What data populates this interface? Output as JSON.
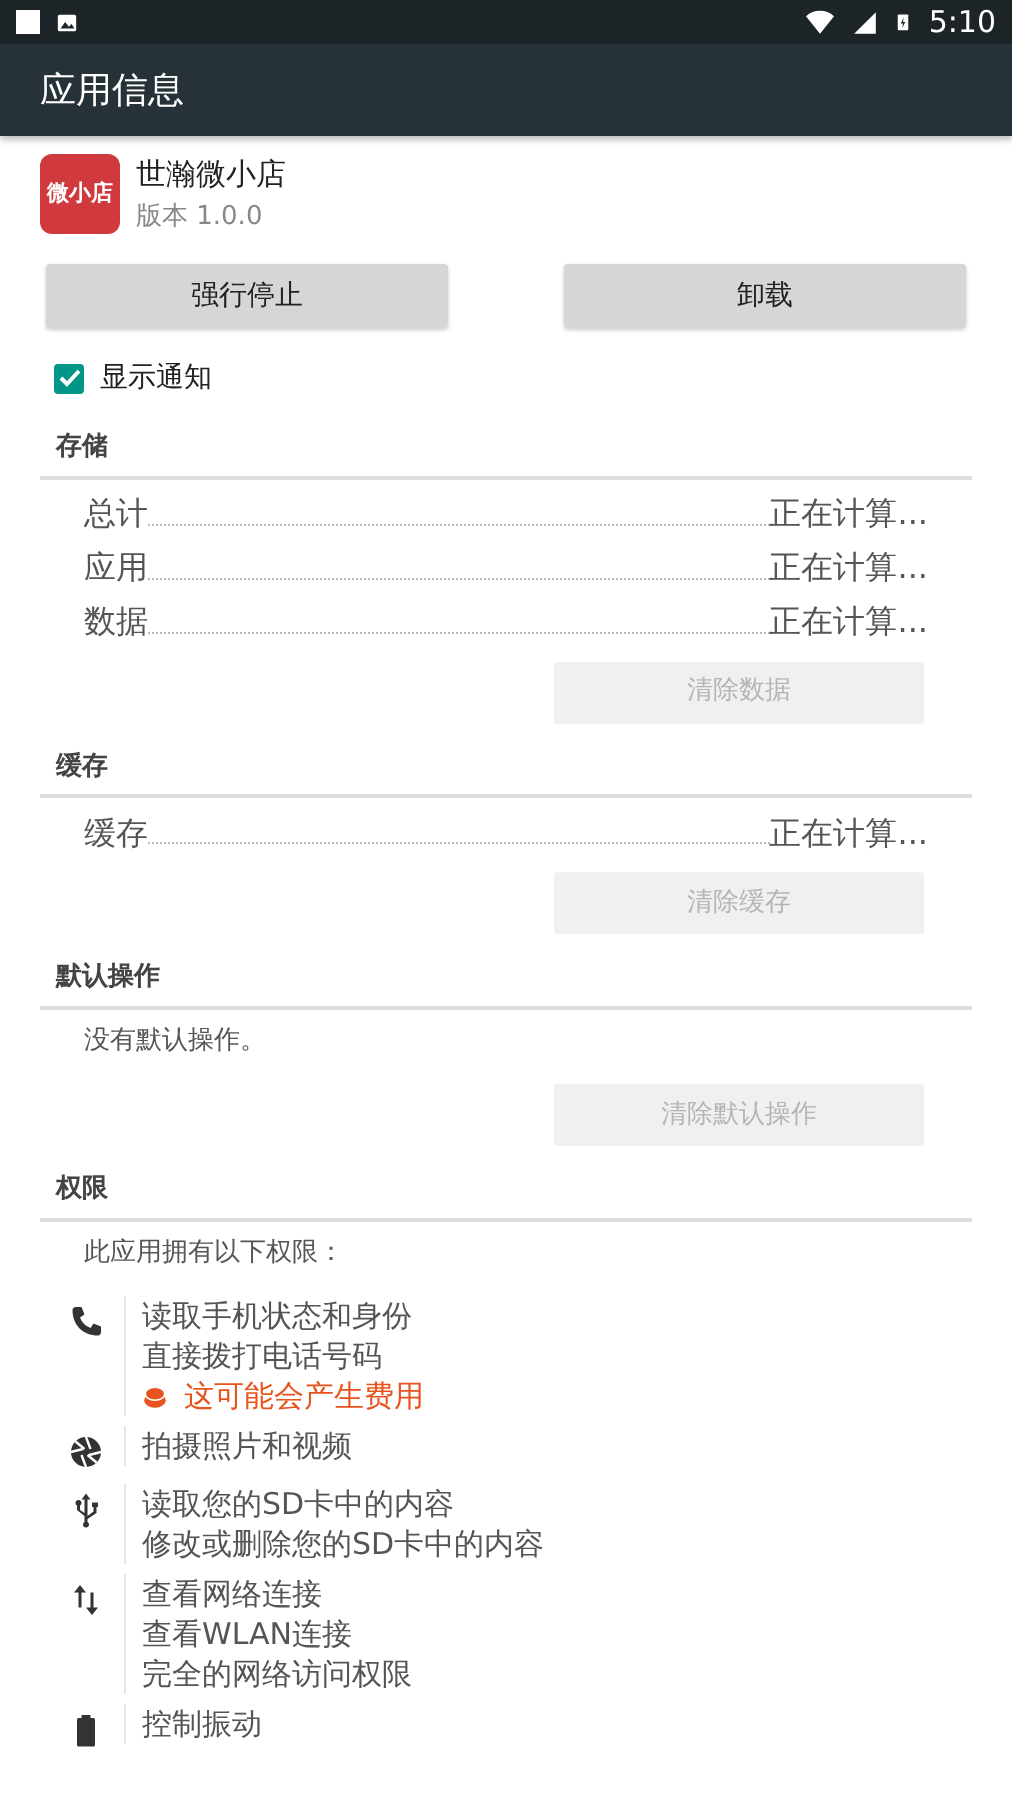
{
  "status_bar": {
    "time": "5:10"
  },
  "app_bar": {
    "title": "应用信息"
  },
  "app": {
    "name": "世瀚微小店",
    "version": "版本 1.0.0",
    "icon_text": "微小店"
  },
  "buttons": [
    {
      "label": "强行停止",
      "disabled": false
    },
    {
      "label": "卸载",
      "disabled": false
    }
  ],
  "notifications": {
    "label": "显示通知",
    "checked": true
  },
  "sections": [
    {
      "title": "存储",
      "rows": [
        {
          "label": "总计",
          "value": "正在计算..."
        },
        {
          "label": "应用",
          "value": "正在计算..."
        },
        {
          "label": "数据",
          "value": "正在计算..."
        }
      ],
      "button": {
        "label": "清除数据",
        "disabled": true
      }
    },
    {
      "title": "缓存",
      "rows": [
        {
          "label": "缓存",
          "value": "正在计算..."
        }
      ],
      "button": {
        "label": "清除缓存",
        "disabled": true
      }
    },
    {
      "title": "默认操作",
      "note": "没有默认操作。",
      "button": {
        "label": "清除默认操作",
        "disabled": true
      }
    }
  ],
  "permissions": {
    "title": "权限",
    "intro": "此应用拥有以下权限：",
    "groups": [
      {
        "kind": "phone",
        "lines": [
          {
            "kind": "normal",
            "text": "读取手机状态和身份"
          },
          {
            "kind": "normal",
            "text": "直接拨打电话号码"
          },
          {
            "kind": "cost",
            "text": "这可能会产生费用"
          }
        ]
      },
      {
        "kind": "camera",
        "lines": [
          {
            "kind": "normal",
            "text": "拍摄照片和视频"
          }
        ]
      },
      {
        "kind": "usb",
        "lines": [
          {
            "kind": "normal",
            "text": "读取您的SD卡中的内容"
          },
          {
            "kind": "normal",
            "text": "修改或删除您的SD卡中的内容"
          }
        ]
      },
      {
        "kind": "network",
        "lines": [
          {
            "kind": "normal",
            "text": "查看网络连接"
          },
          {
            "kind": "normal",
            "text": "查看WLAN连接"
          },
          {
            "kind": "normal",
            "text": "完全的网络访问权限"
          }
        ]
      },
      {
        "kind": "battery",
        "lines": [
          {
            "kind": "normal",
            "text": "控制振动"
          }
        ]
      }
    ]
  }
}
